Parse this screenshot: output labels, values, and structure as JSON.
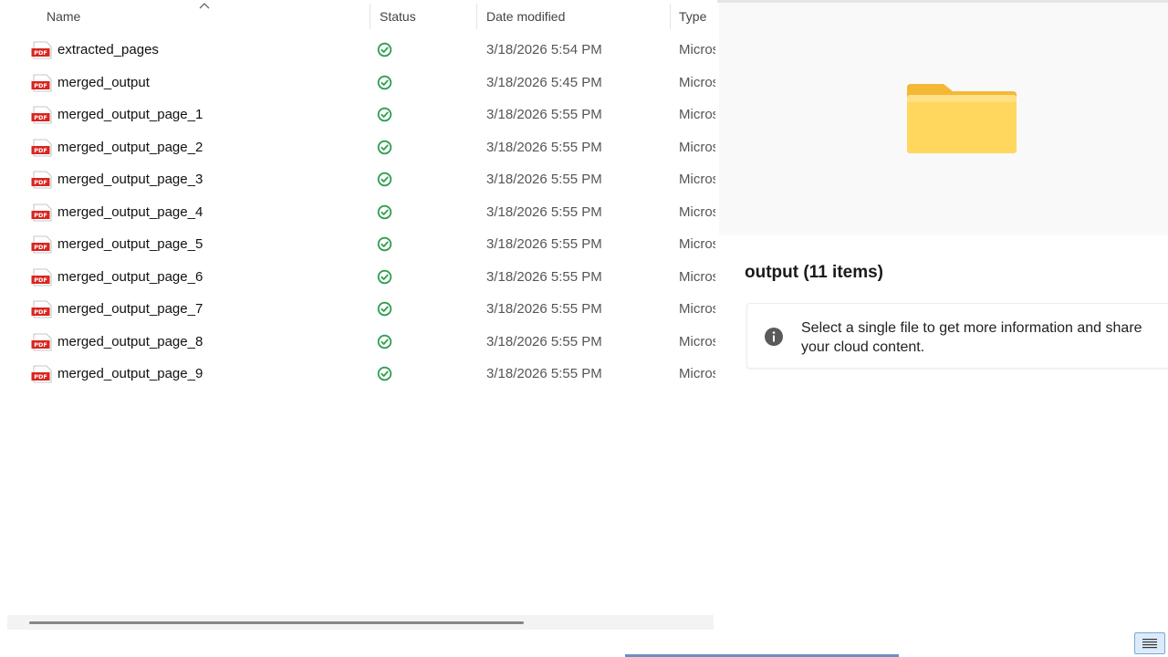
{
  "columns": {
    "name": "Name",
    "status": "Status",
    "date_modified": "Date modified",
    "type": "Type"
  },
  "files": [
    {
      "name": "extracted_pages",
      "date": "3/18/2026 5:54 PM",
      "type": "Microsoft Edge PDF Document"
    },
    {
      "name": "merged_output",
      "date": "3/18/2026 5:45 PM",
      "type": "Microsoft Edge PDF Document"
    },
    {
      "name": "merged_output_page_1",
      "date": "3/18/2026 5:55 PM",
      "type": "Microsoft Edge PDF Document"
    },
    {
      "name": "merged_output_page_2",
      "date": "3/18/2026 5:55 PM",
      "type": "Microsoft Edge PDF Document"
    },
    {
      "name": "merged_output_page_3",
      "date": "3/18/2026 5:55 PM",
      "type": "Microsoft Edge PDF Document"
    },
    {
      "name": "merged_output_page_4",
      "date": "3/18/2026 5:55 PM",
      "type": "Microsoft Edge PDF Document"
    },
    {
      "name": "merged_output_page_5",
      "date": "3/18/2026 5:55 PM",
      "type": "Microsoft Edge PDF Document"
    },
    {
      "name": "merged_output_page_6",
      "date": "3/18/2026 5:55 PM",
      "type": "Microsoft Edge PDF Document"
    },
    {
      "name": "merged_output_page_7",
      "date": "3/18/2026 5:55 PM",
      "type": "Microsoft Edge PDF Document"
    },
    {
      "name": "merged_output_page_8",
      "date": "3/18/2026 5:55 PM",
      "type": "Microsoft Edge PDF Document"
    },
    {
      "name": "merged_output_page_9",
      "date": "3/18/2026 5:55 PM",
      "type": "Microsoft Edge PDF Document"
    }
  ],
  "file_icon": "pdf-icon",
  "status_icon": "synced-check-icon",
  "details": {
    "title": "output (11 items)",
    "info_message": "Select a single file to get more information and share your cloud content.",
    "preview_icon": "folder-icon"
  },
  "colors": {
    "status_green": "#2e9e4f",
    "pdf_red": "#d9251d",
    "folder_yellow": "#ffd75e",
    "accent": "#2b5fa8"
  }
}
